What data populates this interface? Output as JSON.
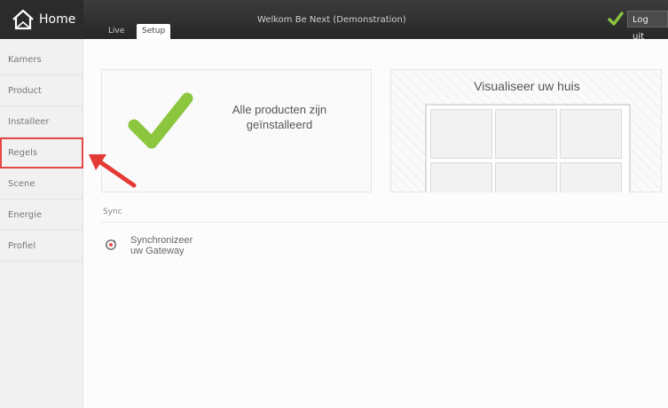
{
  "header": {
    "home_label": "Home",
    "tabs": [
      {
        "label": "Live"
      },
      {
        "label": "Setup"
      }
    ],
    "welcome": "Welkom Be Next (Demonstration)",
    "logout_label": "Log uit"
  },
  "sidebar": {
    "items": [
      {
        "label": "Kamers"
      },
      {
        "label": "Product"
      },
      {
        "label": "Installeer"
      },
      {
        "label": "Regels"
      },
      {
        "label": "Scene"
      },
      {
        "label": "Energie"
      },
      {
        "label": "Profiel"
      }
    ]
  },
  "main": {
    "installed_card": {
      "text_line1": "Alle producten zijn",
      "text_line2": "geïnstalleerd"
    },
    "visual_card": {
      "title": "Visualiseer uw huis"
    },
    "section_label": "Sync",
    "sync_item": {
      "line1": "Synchronizeer",
      "line2": "uw Gateway"
    }
  },
  "colors": {
    "accent_green": "#8cc63f",
    "highlight_red": "#e84747",
    "topbar": "#2e2e2e"
  },
  "icons": {
    "home": "house-outline-icon",
    "status": "check-icon",
    "sync": "sync-icon",
    "annotation": "arrow-icon"
  }
}
